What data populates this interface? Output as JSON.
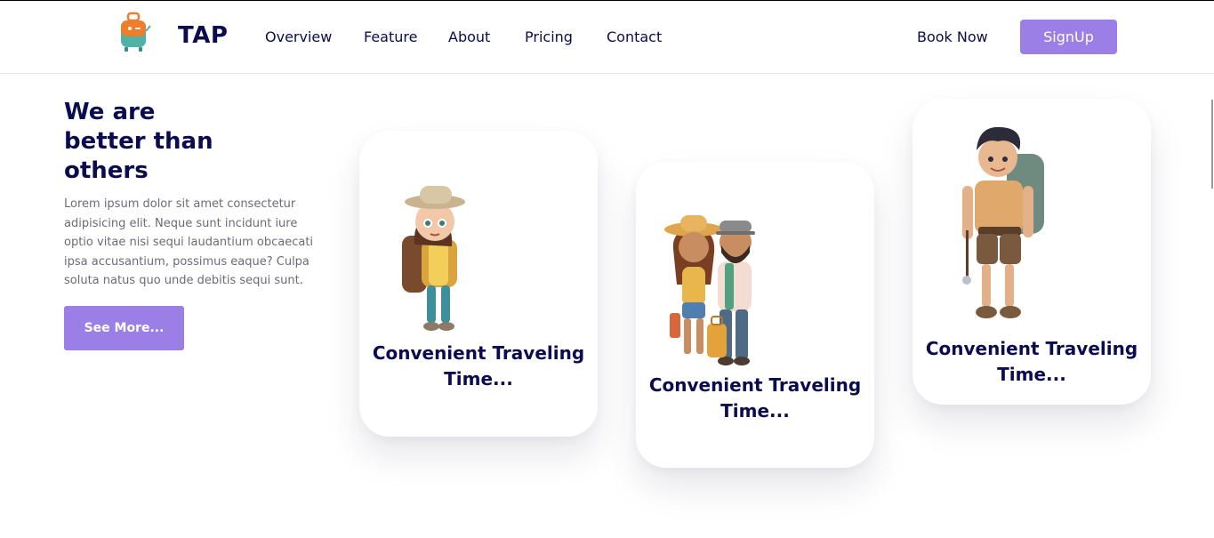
{
  "header": {
    "brand": "TAP",
    "nav": [
      "Overview",
      "Feature",
      "About",
      "Pricing",
      "Contact"
    ],
    "book_now": "Book Now",
    "signup": "SignUp"
  },
  "hero": {
    "title": "We are better than others",
    "text": "Lorem ipsum dolor sit amet consectetur adipisicing elit. Neque sunt incidunt iure optio vitae nisi sequi laudantium obcaecati ipsa accusantium, possimus eaque? Culpa soluta natus quo unde debitis sequi sunt.",
    "button": "See More..."
  },
  "cards": [
    {
      "title": "Convenient Traveling Time...",
      "illustration": "girl-hiker-illustration"
    },
    {
      "title": "Convenient Traveling Time...",
      "illustration": "couple-travelers-illustration"
    },
    {
      "title": "Convenient Traveling Time...",
      "illustration": "boy-backpacker-illustration"
    }
  ],
  "colors": {
    "accent": "#9b7fe6",
    "navy": "#0b0c4f",
    "body_text": "#6b6b7a"
  }
}
